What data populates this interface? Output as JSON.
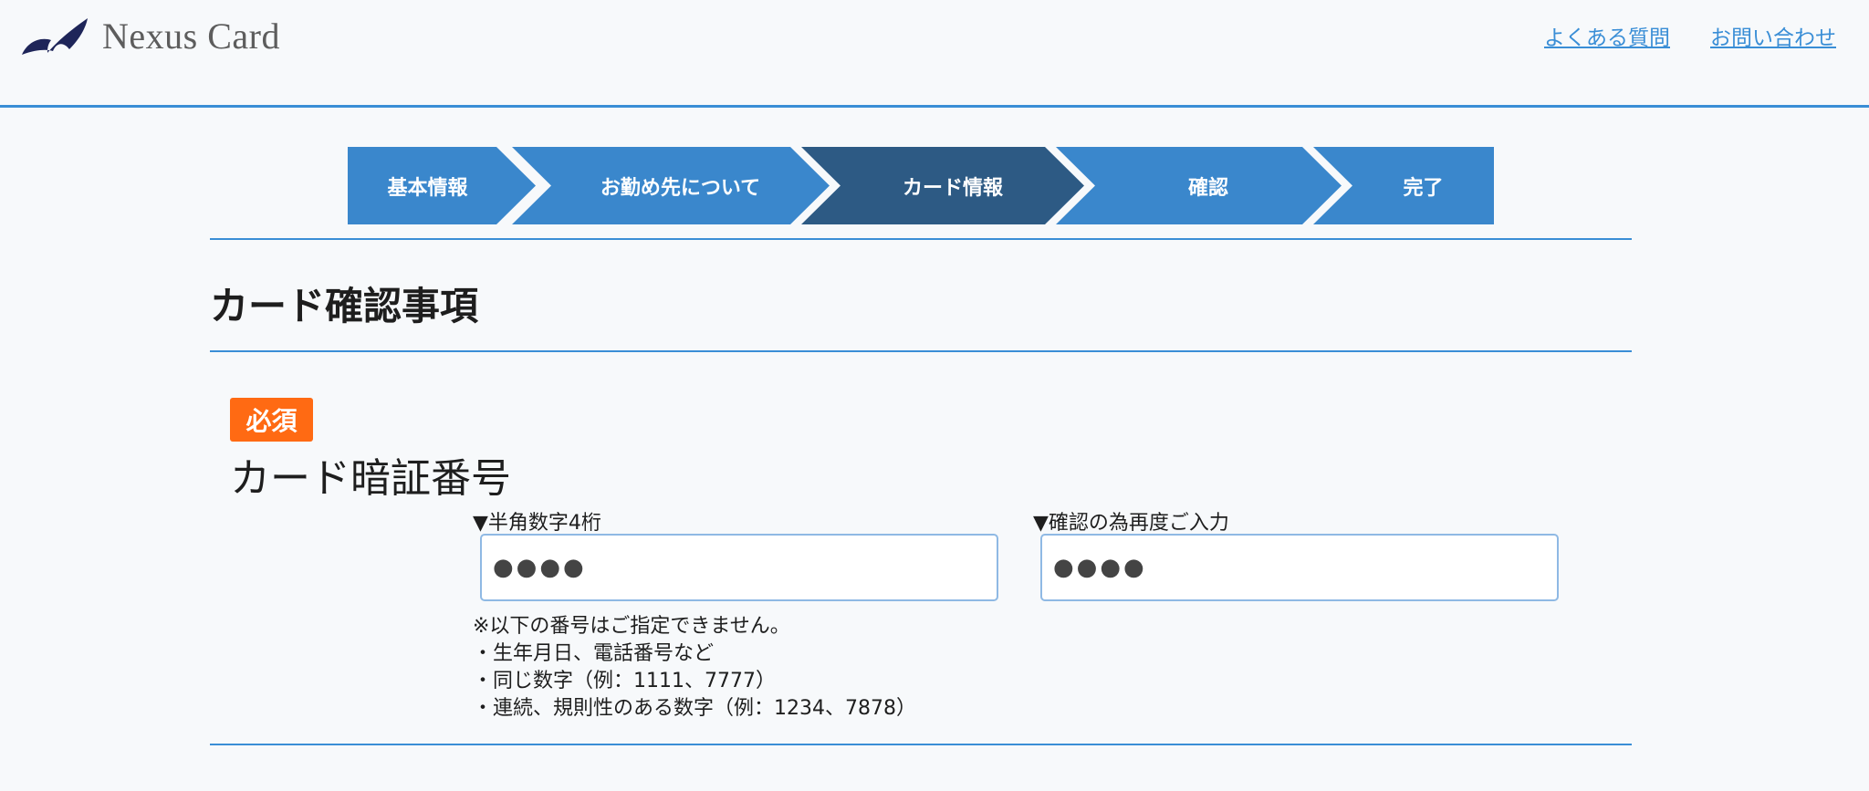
{
  "header": {
    "logo_text": "Nexus Card",
    "links": [
      "よくある質問",
      "お問い合わせ"
    ]
  },
  "steps": {
    "items": [
      "基本情報",
      "お勤め先について",
      "カード情報",
      "確認",
      "完了"
    ],
    "active_index": 2,
    "colors": {
      "default": "#3a87cc",
      "active": "#2d5a84"
    }
  },
  "section": {
    "title": "カード確認事項"
  },
  "pin_field": {
    "required_badge": "必須",
    "label": "カード暗証番号",
    "input1_caption": "▼半角数字4桁",
    "input1_value": "●●●●",
    "input2_caption": "▼確認の為再度ご入力",
    "input2_value": "●●●●",
    "notes": [
      "※以下の番号はご指定できません。",
      "・生年月日、電話番号など",
      "・同じ数字（例：1111、7777）",
      "・連続、規則性のある数字（例：1234、7878）"
    ]
  },
  "colors": {
    "accent": "#3a8ed6",
    "badge": "#ff6a13",
    "background": "#f7f9fb"
  }
}
